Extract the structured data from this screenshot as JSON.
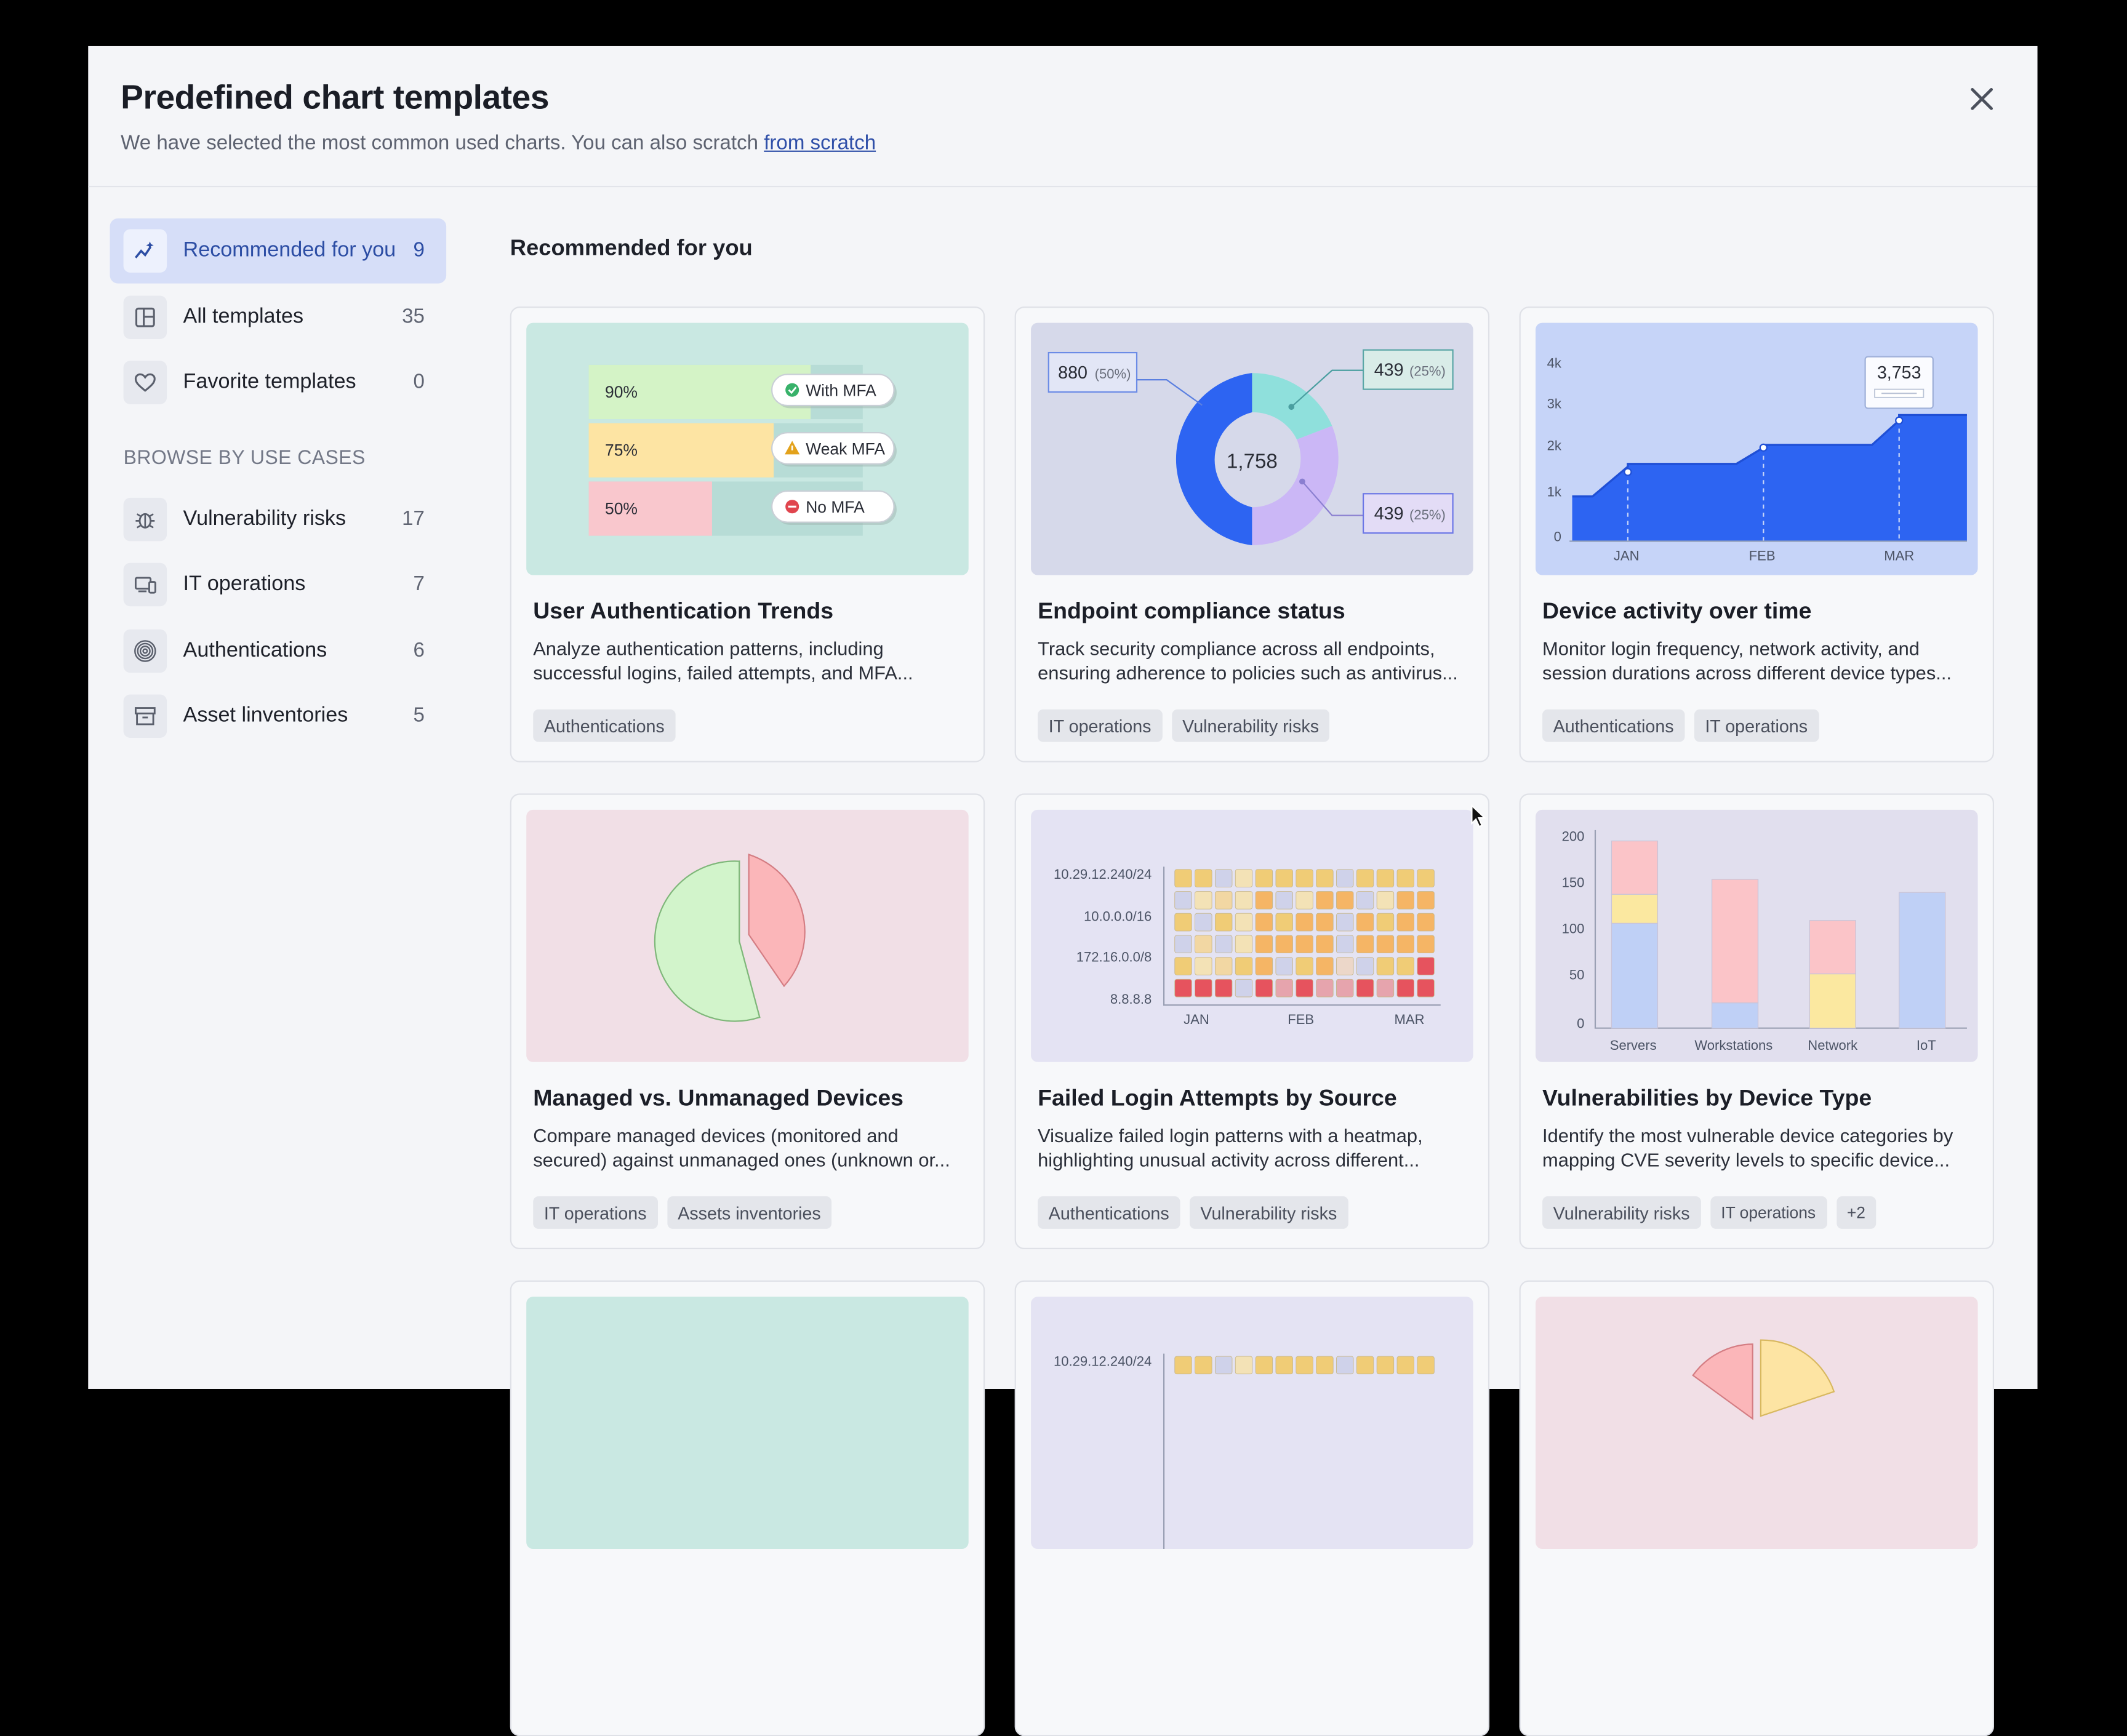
{
  "modal": {
    "title": "Predefined chart templates",
    "subtitle": "We have selected the most common used charts. You can also scratch",
    "subtitle_link": "from scratch"
  },
  "sidebar": {
    "items": [
      {
        "label": "Recommended for you",
        "count": "9",
        "icon": "sparkle-chart-icon",
        "active": true
      },
      {
        "label": "All templates",
        "count": "35",
        "icon": "layout-icon",
        "active": false
      },
      {
        "label": "Favorite templates",
        "count": "0",
        "icon": "heart-icon",
        "active": false
      }
    ],
    "section_label": "BROWSE BY USE CASES",
    "use_cases": [
      {
        "label": "Vulnerability risks",
        "count": "17",
        "icon": "bug-icon"
      },
      {
        "label": "IT operations",
        "count": "7",
        "icon": "devices-icon"
      },
      {
        "label": "Authentications",
        "count": "6",
        "icon": "fingerprint-icon"
      },
      {
        "label": "Asset linventories",
        "count": "5",
        "icon": "archive-icon"
      }
    ]
  },
  "main": {
    "section_title": "Recommended for you",
    "cards": [
      {
        "title": "User Authentication Trends",
        "description": "Analyze authentication patterns, including successful logins, failed attempts, and MFA...",
        "tags": [
          "Authentications"
        ]
      },
      {
        "title": "Endpoint compliance status",
        "description": "Track security compliance across all endpoints, ensuring adherence to policies such as antivirus...",
        "tags": [
          "IT operations",
          "Vulnerability risks"
        ]
      },
      {
        "title": "Device activity over time",
        "description": "Monitor login frequency, network activity, and session durations across different device types...",
        "tags": [
          "Authentications",
          "IT operations"
        ]
      },
      {
        "title": "Managed vs. Unmanaged Devices",
        "description": "Compare managed devices (monitored and secured) against unmanaged ones (unknown or...",
        "tags": [
          "IT operations",
          "Assets inventories"
        ]
      },
      {
        "title": "Failed Login Attempts by Source",
        "description": "Visualize failed login patterns with a heatmap, highlighting unusual activity across different...",
        "tags": [
          "Authentications",
          "Vulnerability risks"
        ]
      },
      {
        "title": "Vulnerabilities by Device Type",
        "description": "Identify the most vulnerable device categories by mapping CVE severity levels to specific device...",
        "tags": [
          "Vulnerability risks",
          "IT operations",
          "+2"
        ]
      }
    ]
  },
  "thumbs": {
    "auth": {
      "rows": [
        {
          "pct": "90%",
          "label": "With MFA",
          "fill": 0.9,
          "color": "#d4f3c6",
          "icon": "check-circle-icon"
        },
        {
          "pct": "75%",
          "label": "Weak MFA",
          "fill": 0.75,
          "color": "#fde4a3",
          "icon": "warning-icon"
        },
        {
          "pct": "50%",
          "label": "No MFA",
          "fill": 0.5,
          "color": "#f9c7cd",
          "icon": "blocked-icon"
        }
      ]
    },
    "donut": {
      "total": "1,758",
      "callouts": [
        {
          "value": "880",
          "pct": "(50%)"
        },
        {
          "value": "439",
          "pct": "(25%)"
        },
        {
          "value": "439",
          "pct": "(25%)"
        }
      ]
    },
    "area": {
      "y_ticks": [
        "4k",
        "3k",
        "2k",
        "1k",
        "0"
      ],
      "x_ticks": [
        "JAN",
        "FEB",
        "MAR"
      ],
      "tooltip": "3,753"
    },
    "heatmap": {
      "rows": [
        "10.29.12.240/24",
        "10.0.0.0/16",
        "172.16.0.0/8",
        "8.8.8.8"
      ],
      "x_ticks": [
        "JAN",
        "FEB",
        "MAR"
      ]
    },
    "bars": {
      "y_ticks": [
        "200",
        "150",
        "100",
        "50",
        "0"
      ],
      "categories": [
        "Servers",
        "Workstations",
        "Network",
        "IoT"
      ],
      "stacks": [
        [
          112,
          31,
          57
        ],
        [
          27,
          0,
          132
        ],
        [
          0,
          58,
          57
        ],
        [
          145,
          0,
          0
        ]
      ],
      "colors": [
        "#bfd0f6",
        "#fbe8a0",
        "#fbc4c8"
      ]
    },
    "peek": {
      "heatmap_label": "10.29.12.240/24"
    }
  },
  "colors": {
    "accent": "#2c4da4",
    "active_bg": "#d6def8",
    "chart_blue": "#2d64f2"
  }
}
